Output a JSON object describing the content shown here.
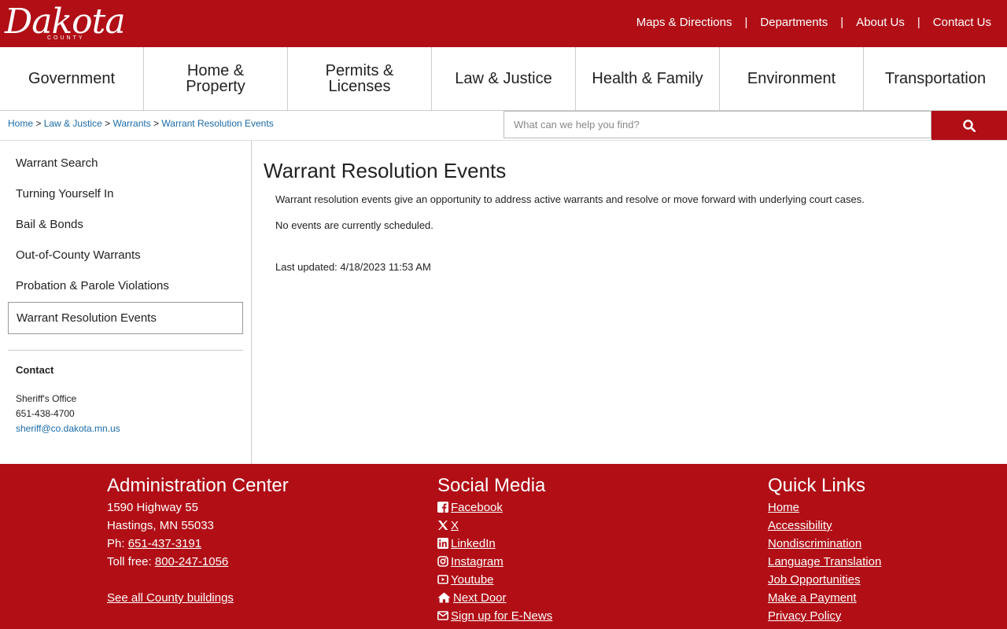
{
  "logo": {
    "word": "Dakota",
    "sub": "COUNTY"
  },
  "utility": [
    "Maps & Directions",
    "Departments",
    "About Us",
    "Contact Us"
  ],
  "utility_sep": "|",
  "nav": [
    {
      "line1": "Government",
      "line2": ""
    },
    {
      "line1": "Home &",
      "line2": "Property"
    },
    {
      "line1": "Permits &",
      "line2": "Licenses"
    },
    {
      "line1": "Law & Justice",
      "line2": ""
    },
    {
      "line1": "Health & Family",
      "line2": ""
    },
    {
      "line1": "Environment",
      "line2": ""
    },
    {
      "line1": "Transportation",
      "line2": ""
    }
  ],
  "breadcrumb": {
    "items": [
      "Home",
      "Law & Justice",
      "Warrants",
      "Warrant Resolution Events"
    ],
    "sep": ">"
  },
  "search": {
    "placeholder": "What can we help you find?",
    "icon": "search-icon"
  },
  "sidebar": {
    "items": [
      "Warrant Search",
      "Turning Yourself In",
      "Bail & Bonds",
      "Out-of-County Warrants",
      "Probation & Parole Violations"
    ],
    "active": "Warrant Resolution Events",
    "contact": {
      "heading": "Contact",
      "name": "Sheriff's Office",
      "phone": "651-438-4700",
      "email": "sheriff@co.dakota.mn.us"
    }
  },
  "main": {
    "title": "Warrant Resolution Events",
    "intro": "Warrant resolution events give an opportunity to address active warrants and resolve or move forward with underlying court cases.",
    "no_events": "No events are currently scheduled.",
    "updated": "Last updated: 4/18/2023 11:53 AM"
  },
  "footer": {
    "admin": {
      "heading": "Administration Center",
      "address1": "1590 Highway 55",
      "address2": "Hastings, MN 55033",
      "phone_label": "Ph: ",
      "phone": "651-437-3191",
      "tollfree_label": "Toll free: ",
      "tollfree": "800-247-1056",
      "buildings": "See all County buildings"
    },
    "social": {
      "heading": "Social Media",
      "items": [
        {
          "label": "Facebook",
          "icon": "facebook-icon"
        },
        {
          "label": "X",
          "icon": "x-icon"
        },
        {
          "label": "LinkedIn",
          "icon": "linkedin-icon"
        },
        {
          "label": "Instagram",
          "icon": "instagram-icon"
        },
        {
          "label": "Youtube",
          "icon": "youtube-icon"
        },
        {
          "label": "Next Door",
          "icon": "home-icon"
        },
        {
          "label": "Sign up for E-News",
          "icon": "envelope-icon"
        }
      ]
    },
    "quick": {
      "heading": "Quick Links",
      "items": [
        "Home",
        "Accessibility",
        "Nondiscrimination",
        "Language Translation",
        "Job Opportunities",
        "Make a Payment",
        "Privacy Policy"
      ]
    }
  },
  "colors": {
    "brand": "#b10e16",
    "link": "#1a6aa8"
  }
}
